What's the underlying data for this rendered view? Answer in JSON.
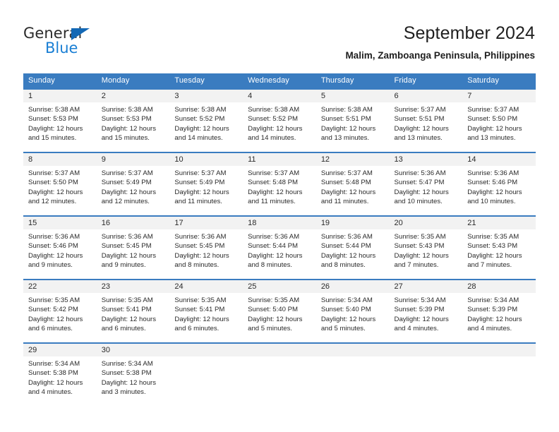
{
  "logo": {
    "word1": "General",
    "word2": "Blue",
    "triangle_color": "#1368b5",
    "word2_color": "#1a7fd4"
  },
  "header": {
    "title": "September 2024",
    "subtitle": "Malim, Zamboanga Peninsula, Philippines"
  },
  "theme": {
    "header_blue": "#3a7cc0",
    "daynum_band": "#f2f2f2",
    "text": "#2a2a2a"
  },
  "calendar": {
    "weekday_headers": [
      "Sunday",
      "Monday",
      "Tuesday",
      "Wednesday",
      "Thursday",
      "Friday",
      "Saturday"
    ],
    "weeks": [
      [
        {
          "day": "1",
          "sunrise": "Sunrise: 5:38 AM",
          "sunset": "Sunset: 5:53 PM",
          "daylight1": "Daylight: 12 hours",
          "daylight2": "and 15 minutes."
        },
        {
          "day": "2",
          "sunrise": "Sunrise: 5:38 AM",
          "sunset": "Sunset: 5:53 PM",
          "daylight1": "Daylight: 12 hours",
          "daylight2": "and 15 minutes."
        },
        {
          "day": "3",
          "sunrise": "Sunrise: 5:38 AM",
          "sunset": "Sunset: 5:52 PM",
          "daylight1": "Daylight: 12 hours",
          "daylight2": "and 14 minutes."
        },
        {
          "day": "4",
          "sunrise": "Sunrise: 5:38 AM",
          "sunset": "Sunset: 5:52 PM",
          "daylight1": "Daylight: 12 hours",
          "daylight2": "and 14 minutes."
        },
        {
          "day": "5",
          "sunrise": "Sunrise: 5:38 AM",
          "sunset": "Sunset: 5:51 PM",
          "daylight1": "Daylight: 12 hours",
          "daylight2": "and 13 minutes."
        },
        {
          "day": "6",
          "sunrise": "Sunrise: 5:37 AM",
          "sunset": "Sunset: 5:51 PM",
          "daylight1": "Daylight: 12 hours",
          "daylight2": "and 13 minutes."
        },
        {
          "day": "7",
          "sunrise": "Sunrise: 5:37 AM",
          "sunset": "Sunset: 5:50 PM",
          "daylight1": "Daylight: 12 hours",
          "daylight2": "and 13 minutes."
        }
      ],
      [
        {
          "day": "8",
          "sunrise": "Sunrise: 5:37 AM",
          "sunset": "Sunset: 5:50 PM",
          "daylight1": "Daylight: 12 hours",
          "daylight2": "and 12 minutes."
        },
        {
          "day": "9",
          "sunrise": "Sunrise: 5:37 AM",
          "sunset": "Sunset: 5:49 PM",
          "daylight1": "Daylight: 12 hours",
          "daylight2": "and 12 minutes."
        },
        {
          "day": "10",
          "sunrise": "Sunrise: 5:37 AM",
          "sunset": "Sunset: 5:49 PM",
          "daylight1": "Daylight: 12 hours",
          "daylight2": "and 11 minutes."
        },
        {
          "day": "11",
          "sunrise": "Sunrise: 5:37 AM",
          "sunset": "Sunset: 5:48 PM",
          "daylight1": "Daylight: 12 hours",
          "daylight2": "and 11 minutes."
        },
        {
          "day": "12",
          "sunrise": "Sunrise: 5:37 AM",
          "sunset": "Sunset: 5:48 PM",
          "daylight1": "Daylight: 12 hours",
          "daylight2": "and 11 minutes."
        },
        {
          "day": "13",
          "sunrise": "Sunrise: 5:36 AM",
          "sunset": "Sunset: 5:47 PM",
          "daylight1": "Daylight: 12 hours",
          "daylight2": "and 10 minutes."
        },
        {
          "day": "14",
          "sunrise": "Sunrise: 5:36 AM",
          "sunset": "Sunset: 5:46 PM",
          "daylight1": "Daylight: 12 hours",
          "daylight2": "and 10 minutes."
        }
      ],
      [
        {
          "day": "15",
          "sunrise": "Sunrise: 5:36 AM",
          "sunset": "Sunset: 5:46 PM",
          "daylight1": "Daylight: 12 hours",
          "daylight2": "and 9 minutes."
        },
        {
          "day": "16",
          "sunrise": "Sunrise: 5:36 AM",
          "sunset": "Sunset: 5:45 PM",
          "daylight1": "Daylight: 12 hours",
          "daylight2": "and 9 minutes."
        },
        {
          "day": "17",
          "sunrise": "Sunrise: 5:36 AM",
          "sunset": "Sunset: 5:45 PM",
          "daylight1": "Daylight: 12 hours",
          "daylight2": "and 8 minutes."
        },
        {
          "day": "18",
          "sunrise": "Sunrise: 5:36 AM",
          "sunset": "Sunset: 5:44 PM",
          "daylight1": "Daylight: 12 hours",
          "daylight2": "and 8 minutes."
        },
        {
          "day": "19",
          "sunrise": "Sunrise: 5:36 AM",
          "sunset": "Sunset: 5:44 PM",
          "daylight1": "Daylight: 12 hours",
          "daylight2": "and 8 minutes."
        },
        {
          "day": "20",
          "sunrise": "Sunrise: 5:35 AM",
          "sunset": "Sunset: 5:43 PM",
          "daylight1": "Daylight: 12 hours",
          "daylight2": "and 7 minutes."
        },
        {
          "day": "21",
          "sunrise": "Sunrise: 5:35 AM",
          "sunset": "Sunset: 5:43 PM",
          "daylight1": "Daylight: 12 hours",
          "daylight2": "and 7 minutes."
        }
      ],
      [
        {
          "day": "22",
          "sunrise": "Sunrise: 5:35 AM",
          "sunset": "Sunset: 5:42 PM",
          "daylight1": "Daylight: 12 hours",
          "daylight2": "and 6 minutes."
        },
        {
          "day": "23",
          "sunrise": "Sunrise: 5:35 AM",
          "sunset": "Sunset: 5:41 PM",
          "daylight1": "Daylight: 12 hours",
          "daylight2": "and 6 minutes."
        },
        {
          "day": "24",
          "sunrise": "Sunrise: 5:35 AM",
          "sunset": "Sunset: 5:41 PM",
          "daylight1": "Daylight: 12 hours",
          "daylight2": "and 6 minutes."
        },
        {
          "day": "25",
          "sunrise": "Sunrise: 5:35 AM",
          "sunset": "Sunset: 5:40 PM",
          "daylight1": "Daylight: 12 hours",
          "daylight2": "and 5 minutes."
        },
        {
          "day": "26",
          "sunrise": "Sunrise: 5:34 AM",
          "sunset": "Sunset: 5:40 PM",
          "daylight1": "Daylight: 12 hours",
          "daylight2": "and 5 minutes."
        },
        {
          "day": "27",
          "sunrise": "Sunrise: 5:34 AM",
          "sunset": "Sunset: 5:39 PM",
          "daylight1": "Daylight: 12 hours",
          "daylight2": "and 4 minutes."
        },
        {
          "day": "28",
          "sunrise": "Sunrise: 5:34 AM",
          "sunset": "Sunset: 5:39 PM",
          "daylight1": "Daylight: 12 hours",
          "daylight2": "and 4 minutes."
        }
      ],
      [
        {
          "day": "29",
          "sunrise": "Sunrise: 5:34 AM",
          "sunset": "Sunset: 5:38 PM",
          "daylight1": "Daylight: 12 hours",
          "daylight2": "and 4 minutes."
        },
        {
          "day": "30",
          "sunrise": "Sunrise: 5:34 AM",
          "sunset": "Sunset: 5:38 PM",
          "daylight1": "Daylight: 12 hours",
          "daylight2": "and 3 minutes."
        },
        {
          "day": "",
          "sunrise": "",
          "sunset": "",
          "daylight1": "",
          "daylight2": ""
        },
        {
          "day": "",
          "sunrise": "",
          "sunset": "",
          "daylight1": "",
          "daylight2": ""
        },
        {
          "day": "",
          "sunrise": "",
          "sunset": "",
          "daylight1": "",
          "daylight2": ""
        },
        {
          "day": "",
          "sunrise": "",
          "sunset": "",
          "daylight1": "",
          "daylight2": ""
        },
        {
          "day": "",
          "sunrise": "",
          "sunset": "",
          "daylight1": "",
          "daylight2": ""
        }
      ]
    ]
  }
}
